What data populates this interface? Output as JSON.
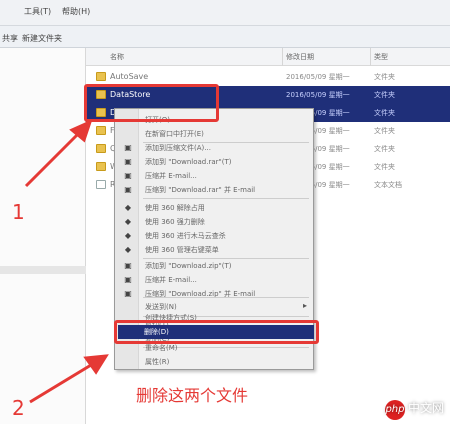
{
  "menubar": {
    "items": [
      "工具(T)",
      "帮助(H)"
    ]
  },
  "toolbar": {
    "items": [
      "共享",
      "新建文件夹"
    ]
  },
  "columns": [
    "名称",
    "修改日期",
    "类型"
  ],
  "files": [
    {
      "name": "AutoSave",
      "date": "2016/05/09 星期一",
      "type": "文件夹",
      "selected": false,
      "kind": "folder"
    },
    {
      "name": "DataStore",
      "date": "2016/05/09 星期一",
      "type": "文件夹",
      "selected": true,
      "kind": "folder"
    },
    {
      "name": "Download",
      "date": "2016/05/09 星期一",
      "type": "文件夹",
      "selected": true,
      "kind": "folder"
    },
    {
      "name": "Font",
      "date": "2016/05/09 星期一",
      "type": "文件夹",
      "selected": false,
      "kind": "folder"
    },
    {
      "name": "Quick",
      "date": "2016/05/09 星期一",
      "type": "文件夹",
      "selected": false,
      "kind": "folder"
    },
    {
      "name": "Wall",
      "date": "2016/05/09 星期一",
      "type": "文件夹",
      "selected": false,
      "kind": "folder"
    },
    {
      "name": "Repo",
      "date": "2016/05/09 星期一",
      "type": "文本文档",
      "selected": false,
      "kind": "file"
    }
  ],
  "context_menu": {
    "items_top": [
      "打开(O)",
      "在新窗口中打开(E)",
      "添加到压缩文件(A)...",
      "添加到 \"Download.rar\"(T)",
      "压缩并 E-mail...",
      "压缩到 \"Download.rar\" 并 E-mail",
      "使用 360 解除占用",
      "使用 360 强力删除",
      "使用 360 进行木马云查杀",
      "使用 360 管理右键菜单",
      "添加到 \"Download.zip\"(T)",
      "压缩并 E-mail...",
      "压缩到 \"Download.zip\" 并 E-mail"
    ],
    "send_to": "发送到(N)",
    "cut": "剪切(T)",
    "copy": "复制(C)",
    "create_shortcut": "创建快捷方式(S)",
    "delete": "删除(D)",
    "rename": "重命名(M)",
    "properties": "属性(R)"
  },
  "annotation": {
    "step1": "1",
    "step2": "2",
    "text": "删除这两个文件",
    "color": "#e53935"
  },
  "watermark": {
    "badge": "php",
    "text": "中文网"
  }
}
